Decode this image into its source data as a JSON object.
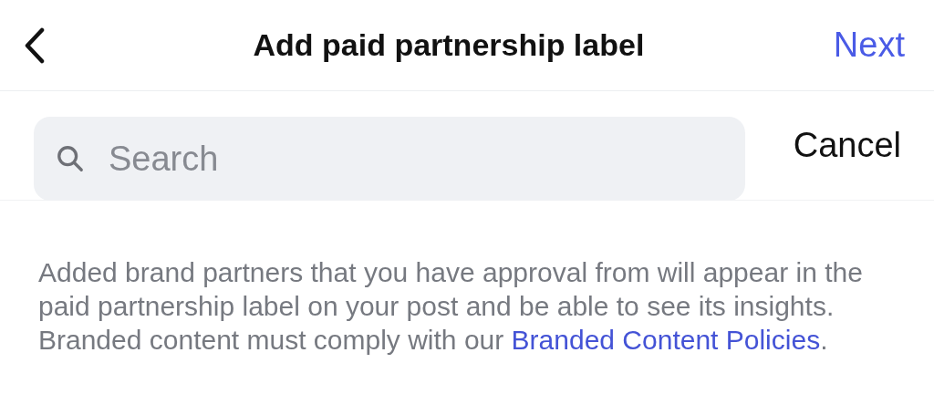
{
  "header": {
    "title": "Add paid partnership label",
    "next": "Next"
  },
  "search": {
    "placeholder": "Search",
    "cancel": "Cancel"
  },
  "notice": {
    "text": "Added brand partners that you have approval from will appear in the paid partnership label on your post and be able to see its insights. Branded content must comply with our ",
    "link": "Branded Content Policies",
    "after": "."
  }
}
